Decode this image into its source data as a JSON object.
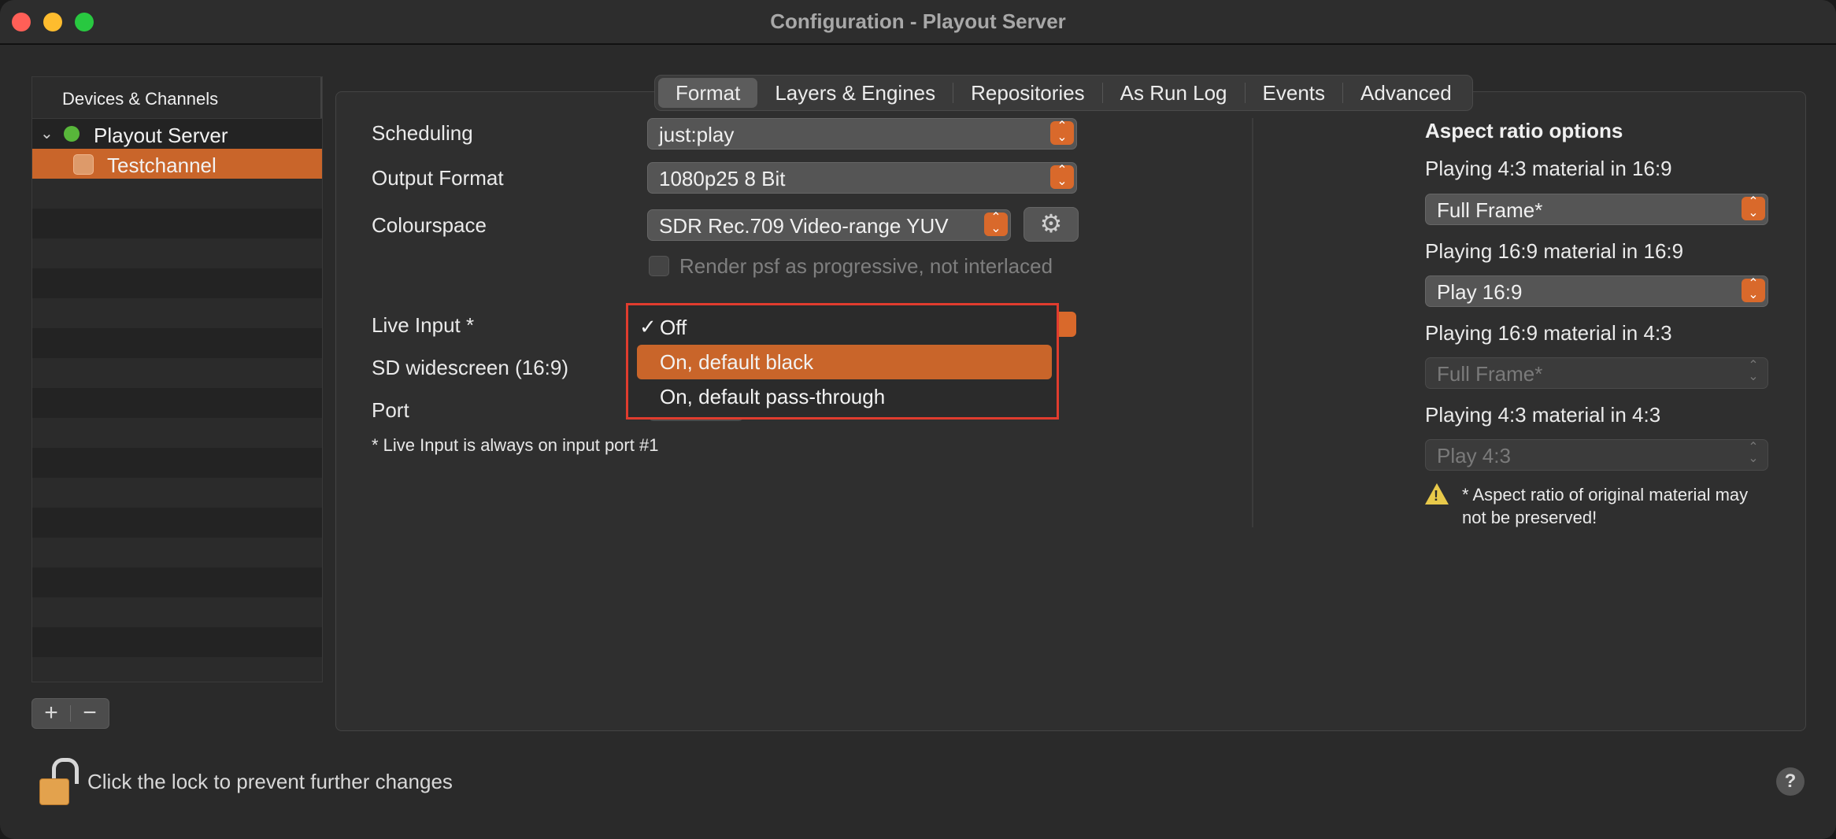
{
  "window": {
    "title": "Configuration - Playout Server"
  },
  "sidebar": {
    "header": "Devices & Channels",
    "items": [
      {
        "label": "Playout Server",
        "status_color": "#58b73a",
        "expanded": true
      },
      {
        "label": "Testchannel",
        "selected": true
      }
    ],
    "add_label": "+",
    "remove_label": "−"
  },
  "tabs": [
    "Format",
    "Layers & Engines",
    "Repositories",
    "As Run Log",
    "Events",
    "Advanced"
  ],
  "active_tab": "Format",
  "format": {
    "scheduling": {
      "label": "Scheduling",
      "value": "just:play"
    },
    "output_format": {
      "label": "Output Format",
      "value": "1080p25 8 Bit"
    },
    "colourspace": {
      "label": "Colourspace",
      "value": "SDR Rec.709 Video-range YUV"
    },
    "render_psf": {
      "label": "Render psf as progressive, not interlaced",
      "checked": false,
      "enabled": false
    },
    "live_input": {
      "label": "Live Input *"
    },
    "sd_widescreen": {
      "label": "SD widescreen (16:9)"
    },
    "port": {
      "label": "Port"
    },
    "footnote": "* Live Input is always on input port #1"
  },
  "live_input_menu": {
    "options": [
      "Off",
      "On, default black",
      "On, default pass-through"
    ],
    "checked_index": 0,
    "highlighted_index": 1,
    "check_mark": "✓"
  },
  "aspect": {
    "title": "Aspect ratio options",
    "rows": [
      {
        "label": "Playing 4:3 material in 16:9",
        "value": "Full Frame*",
        "enabled": true
      },
      {
        "label": "Playing 16:9 material in 16:9",
        "value": "Play 16:9",
        "enabled": true
      },
      {
        "label": "Playing 16:9 material in 4:3",
        "value": "Full Frame*",
        "enabled": false
      },
      {
        "label": "Playing 4:3 material in 4:3",
        "value": "Play 4:3",
        "enabled": false
      }
    ],
    "warning": "* Aspect ratio of original material may not be preserved!"
  },
  "footer": {
    "lock_text": "Click the lock to prevent further changes",
    "help": "?"
  },
  "colors": {
    "accent": "#d9692b",
    "selection": "#c9652a",
    "menu_outline": "#e03c2e"
  }
}
